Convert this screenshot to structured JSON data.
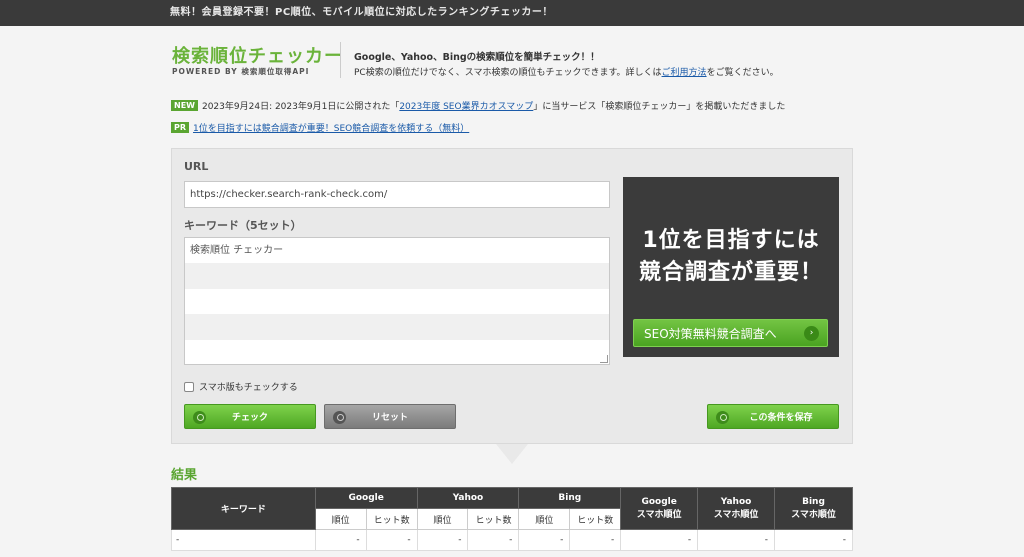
{
  "topbar": {
    "text": "無料！会員登録不要！PC順位、モバイル順位に対応したランキングチェッカー！"
  },
  "header": {
    "logo_title": "検索順位チェッカー",
    "logo_subtitle": "POWERED BY 検索順位取得API",
    "desc_line1": "Google、Yahoo、Bingの検索順位を簡単チェック！！",
    "desc_line2_before": "PC検索の順位だけでなく、スマホ検索の順位もチェックできます。詳しくは",
    "desc_line2_link": "ご利用方法",
    "desc_line2_after": "をご覧ください。"
  },
  "notices": {
    "new_badge": "NEW",
    "new_text_before": "2023年9月24日: 2023年9月1日に公開された「",
    "new_link": "2023年度 SEO業界カオスマップ",
    "new_text_after": "」に当サービス「検索順位チェッカー」を掲載いただきました",
    "pr_badge": "PR",
    "pr_link": "1位を目指すには競合調査が重要！SEO競合調査を依頼する（無料）"
  },
  "form": {
    "url_label": "URL",
    "url_value": "https://checker.search-rank-check.com/",
    "keyword_label": "キーワード（5セット）",
    "keywords": [
      "検索順位 チェッカー",
      "",
      "",
      "",
      ""
    ],
    "mobile_check_label": "スマホ版もチェックする",
    "check_button": "チェック",
    "reset_button": "リセット",
    "save_button": "この条件を保存"
  },
  "ad": {
    "line1": "1位を目指すには",
    "line2": "競合調査が重要！",
    "button": "SEO対策無料競合調査へ",
    "button_arrow": "›"
  },
  "results": {
    "title": "結果",
    "col_keyword": "キーワード",
    "col_google": "Google",
    "col_yahoo": "Yahoo",
    "col_bing": "Bing",
    "col_google_sp": [
      "Google",
      "スマホ順位"
    ],
    "col_yahoo_sp": [
      "Yahoo",
      "スマホ順位"
    ],
    "col_bing_sp": [
      "Bing",
      "スマホ順位"
    ],
    "sub_rank": "順位",
    "sub_hits": "ヒット数",
    "rows": [
      [
        "-",
        "-",
        "-",
        "-",
        "-",
        "-",
        "-",
        "-",
        "-",
        "-"
      ]
    ]
  },
  "colors": {
    "accent_green": "#5aa531",
    "dark": "#3b3b3b"
  }
}
